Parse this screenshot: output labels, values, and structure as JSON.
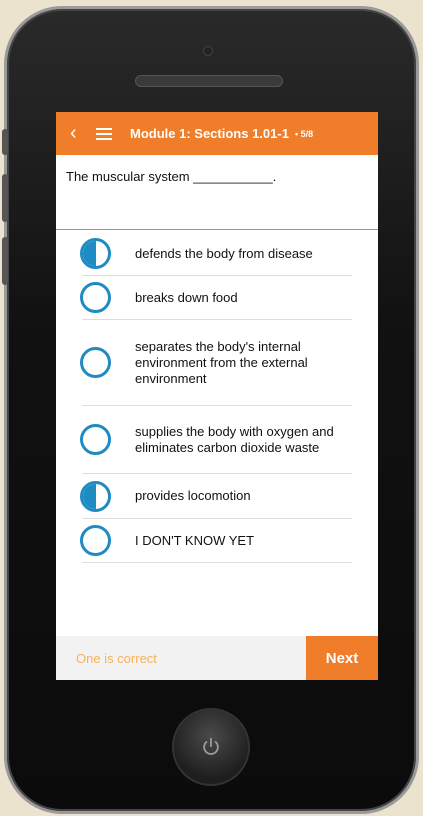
{
  "header": {
    "back_icon": "chevron-left-icon",
    "menu_icon": "hamburger-menu-icon",
    "title": "Module 1: Sections 1.01-1",
    "progress": "• 5/8",
    "bg_color": "#f07d2a"
  },
  "question": {
    "text": "The muscular system ___________."
  },
  "options": [
    {
      "label": "defends the body from disease",
      "state": "half-filled"
    },
    {
      "label": "breaks down food",
      "state": "empty"
    },
    {
      "label": "separates the body's internal environment from the external environment",
      "state": "empty"
    },
    {
      "label": "supplies the body with oxygen and eliminates carbon dioxide waste",
      "state": "empty"
    },
    {
      "label": "provides locomotion",
      "state": "half-filled"
    },
    {
      "label": "I DON'T KNOW YET",
      "state": "empty"
    }
  ],
  "footer": {
    "hint": "One is correct",
    "next_label": "Next"
  },
  "colors": {
    "accent": "#f07d2a",
    "radio": "#1e8bc3",
    "hint": "#f5b35a"
  },
  "device": {
    "home_icon": "power-icon"
  }
}
